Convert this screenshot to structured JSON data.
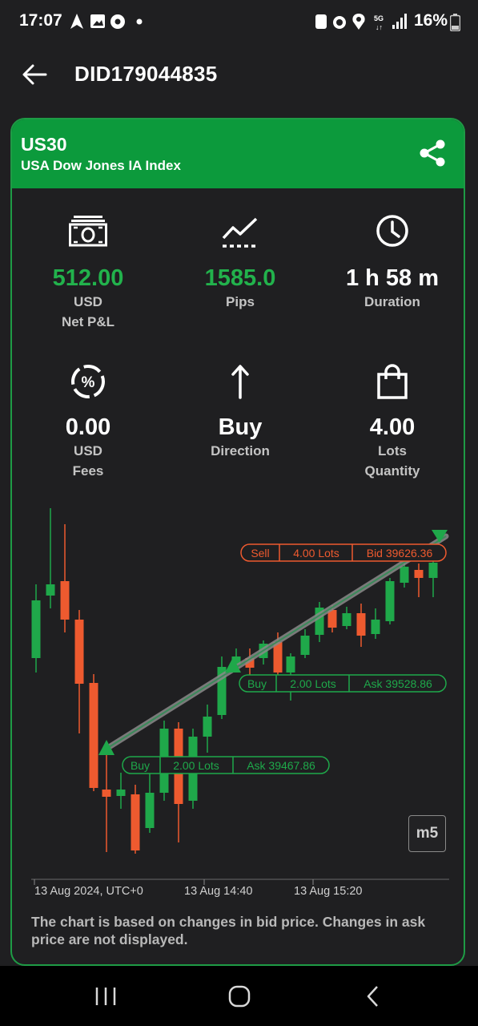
{
  "status_bar": {
    "time": "17:07",
    "battery_pct": "16%"
  },
  "header": {
    "title": "DID179044835"
  },
  "instrument": {
    "symbol": "US30",
    "description": "USA Dow Jones IA Index"
  },
  "stats": [
    {
      "id": "net_pl",
      "icon": "banknote-icon",
      "value": "512.00",
      "unit": "USD",
      "label": "Net P&L",
      "color": "#22b24c"
    },
    {
      "id": "pips",
      "icon": "trend-line-icon",
      "value": "1585.0",
      "unit": "",
      "label": "Pips",
      "color": "#22b24c"
    },
    {
      "id": "duration",
      "icon": "clock-icon",
      "value": "1 h 58 m",
      "unit": "",
      "label": "Duration",
      "color": "#ffffff"
    },
    {
      "id": "fees",
      "icon": "percent-circle-icon",
      "value": "0.00",
      "unit": "USD",
      "label": "Fees",
      "color": "#ffffff"
    },
    {
      "id": "direction",
      "icon": "arrow-up-icon",
      "value": "Buy",
      "unit": "",
      "label": "Direction",
      "color": "#ffffff"
    },
    {
      "id": "quantity",
      "icon": "shopping-bag-icon",
      "value": "4.00",
      "unit": "Lots",
      "label": "Quantity",
      "color": "#ffffff"
    }
  ],
  "chart": {
    "timeframe": "m5",
    "x_labels": [
      "13 Aug 2024, UTC+0",
      "13 Aug 14:40",
      "13 Aug 15:20"
    ],
    "annotations": [
      {
        "side": "Sell",
        "lots": "4.00 Lots",
        "price": "Bid 39626.36",
        "color": "#ee5a2f"
      },
      {
        "side": "Buy",
        "lots": "2.00 Lots",
        "price": "Ask 39528.86",
        "color": "#22b24c"
      },
      {
        "side": "Buy",
        "lots": "2.00 Lots",
        "price": "Ask 39467.86",
        "color": "#22b24c"
      }
    ],
    "colors": {
      "up": "#1fa84a",
      "down": "#ee5a2f"
    }
  },
  "footnote": "The chart is based on changes in bid price. Changes in ask price are not displayed."
}
